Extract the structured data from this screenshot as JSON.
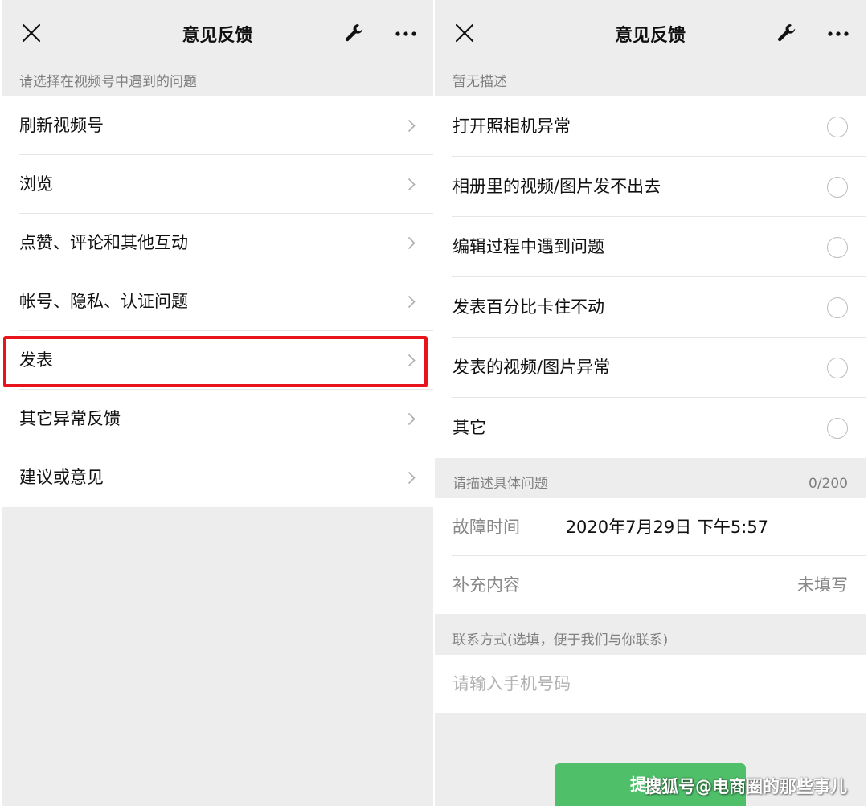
{
  "left": {
    "title": "意见反馈",
    "section_header": "请选择在视频号中遇到的问题",
    "items": [
      {
        "label": "刷新视频号"
      },
      {
        "label": "浏览"
      },
      {
        "label": "点赞、评论和其他互动"
      },
      {
        "label": "帐号、隐私、认证问题"
      },
      {
        "label": "发表",
        "highlighted": true
      },
      {
        "label": "其它异常反馈"
      },
      {
        "label": "建议或意见"
      }
    ]
  },
  "right": {
    "title": "意见反馈",
    "section_header": "暂无描述",
    "options": [
      {
        "label": "打开照相机异常",
        "selected": false
      },
      {
        "label": "相册里的视频/图片发不出去",
        "selected": false
      },
      {
        "label": "编辑过程中遇到问题",
        "selected": false
      },
      {
        "label": "发表百分比卡住不动",
        "selected": false
      },
      {
        "label": "发表的视频/图片异常",
        "selected": false
      },
      {
        "label": "其它",
        "selected": false
      }
    ],
    "describe": {
      "header": "请描述具体问题",
      "count": "0/200",
      "fault_time_label": "故障时间",
      "fault_time_value": "2020年7月29日 下午5:57",
      "supplement_label": "补充内容",
      "supplement_value": "未填写"
    },
    "contact": {
      "header": "联系方式(选填，便于我们与你联系)",
      "placeholder": "请输入手机号码"
    },
    "submit_label": "提交"
  },
  "watermark": "搜狐号@电商圈的那些事儿",
  "colors": {
    "background": "#ededed",
    "highlight": "#e8141b",
    "submit": "#4fbf6a"
  }
}
